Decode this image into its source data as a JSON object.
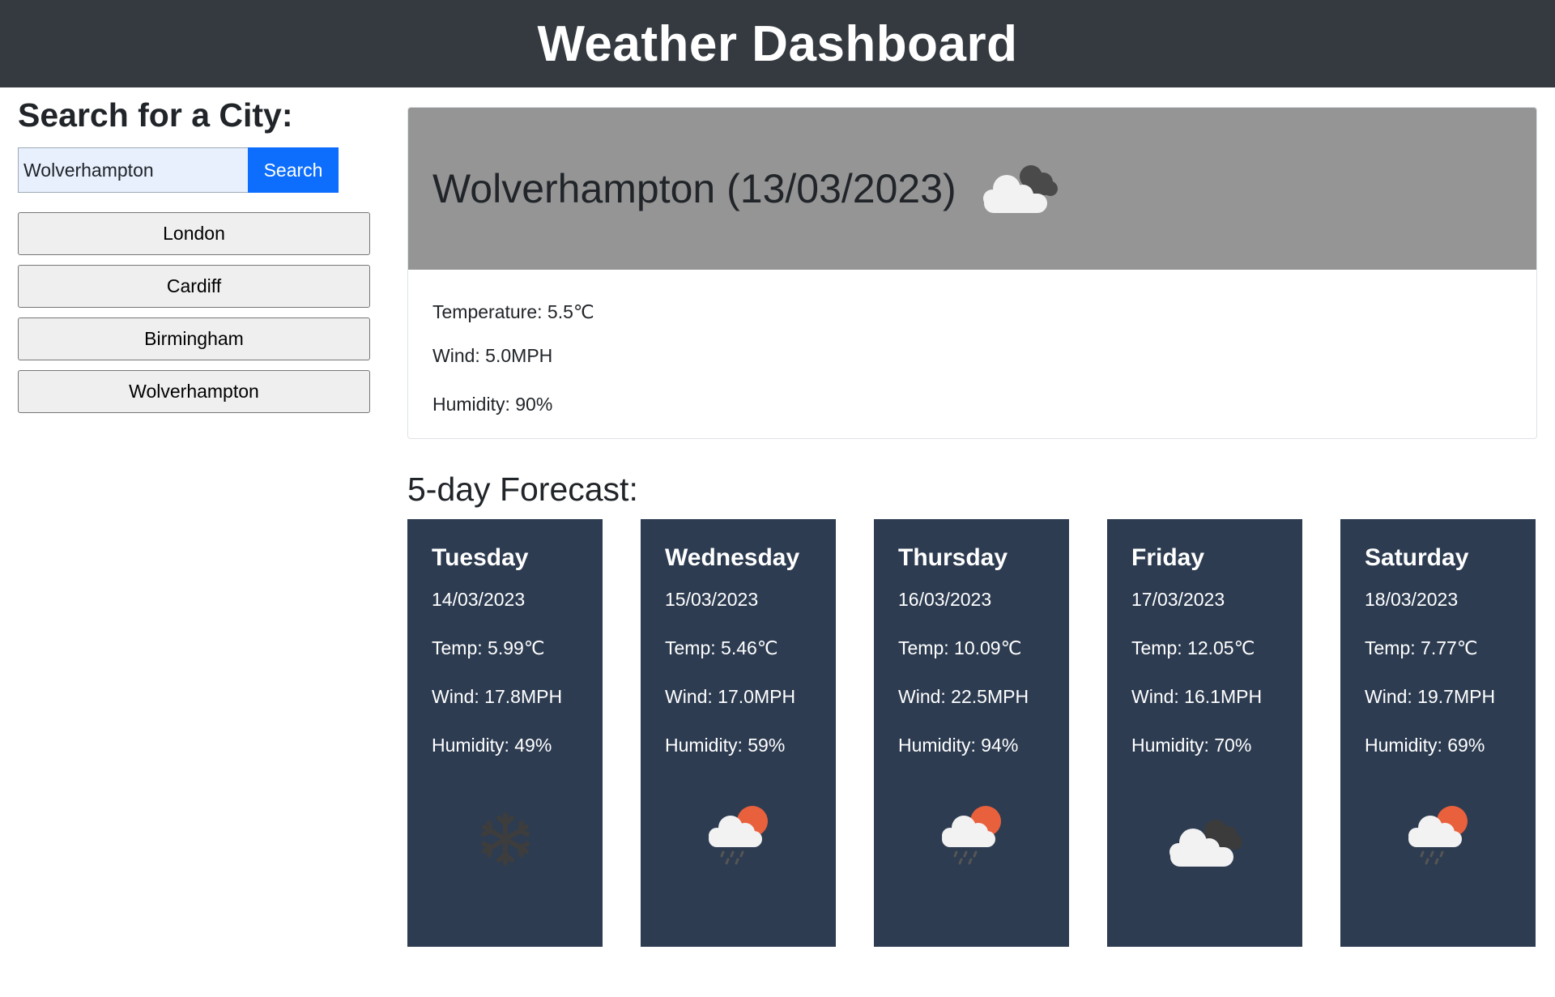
{
  "header": {
    "title": "Weather Dashboard"
  },
  "sidebar": {
    "heading": "Search for a City:",
    "search": {
      "value": "Wolverhampton",
      "button_label": "Search"
    },
    "history": [
      "London",
      "Cardiff",
      "Birmingham",
      "Wolverhampton"
    ]
  },
  "current": {
    "title": "Wolverhampton (13/03/2023)",
    "icon": "broken-clouds-icon",
    "temperature": "Temperature: 5.5℃",
    "wind": "Wind: 5.0MPH",
    "humidity": "Humidity: 90%"
  },
  "forecast": {
    "title": "5-day Forecast:",
    "days": [
      {
        "day": "Tuesday",
        "date": "14/03/2023",
        "temp": "Temp: 5.99℃",
        "wind": "Wind: 17.8MPH",
        "humidity": "Humidity: 49%",
        "icon": "snow-icon"
      },
      {
        "day": "Wednesday",
        "date": "15/03/2023",
        "temp": "Temp: 5.46℃",
        "wind": "Wind: 17.0MPH",
        "humidity": "Humidity: 59%",
        "icon": "rain-sun-icon"
      },
      {
        "day": "Thursday",
        "date": "16/03/2023",
        "temp": "Temp: 10.09℃",
        "wind": "Wind: 22.5MPH",
        "humidity": "Humidity: 94%",
        "icon": "rain-sun-icon"
      },
      {
        "day": "Friday",
        "date": "17/03/2023",
        "temp": "Temp: 12.05℃",
        "wind": "Wind: 16.1MPH",
        "humidity": "Humidity: 70%",
        "icon": "broken-clouds-icon"
      },
      {
        "day": "Saturday",
        "date": "18/03/2023",
        "temp": "Temp: 7.77℃",
        "wind": "Wind: 19.7MPH",
        "humidity": "Humidity: 69%",
        "icon": "rain-sun-icon"
      }
    ]
  },
  "colors": {
    "header_bg": "#343a40",
    "card_bg": "#2d3c51",
    "current_head_bg": "#959595",
    "search_button": "#0d6efd"
  }
}
